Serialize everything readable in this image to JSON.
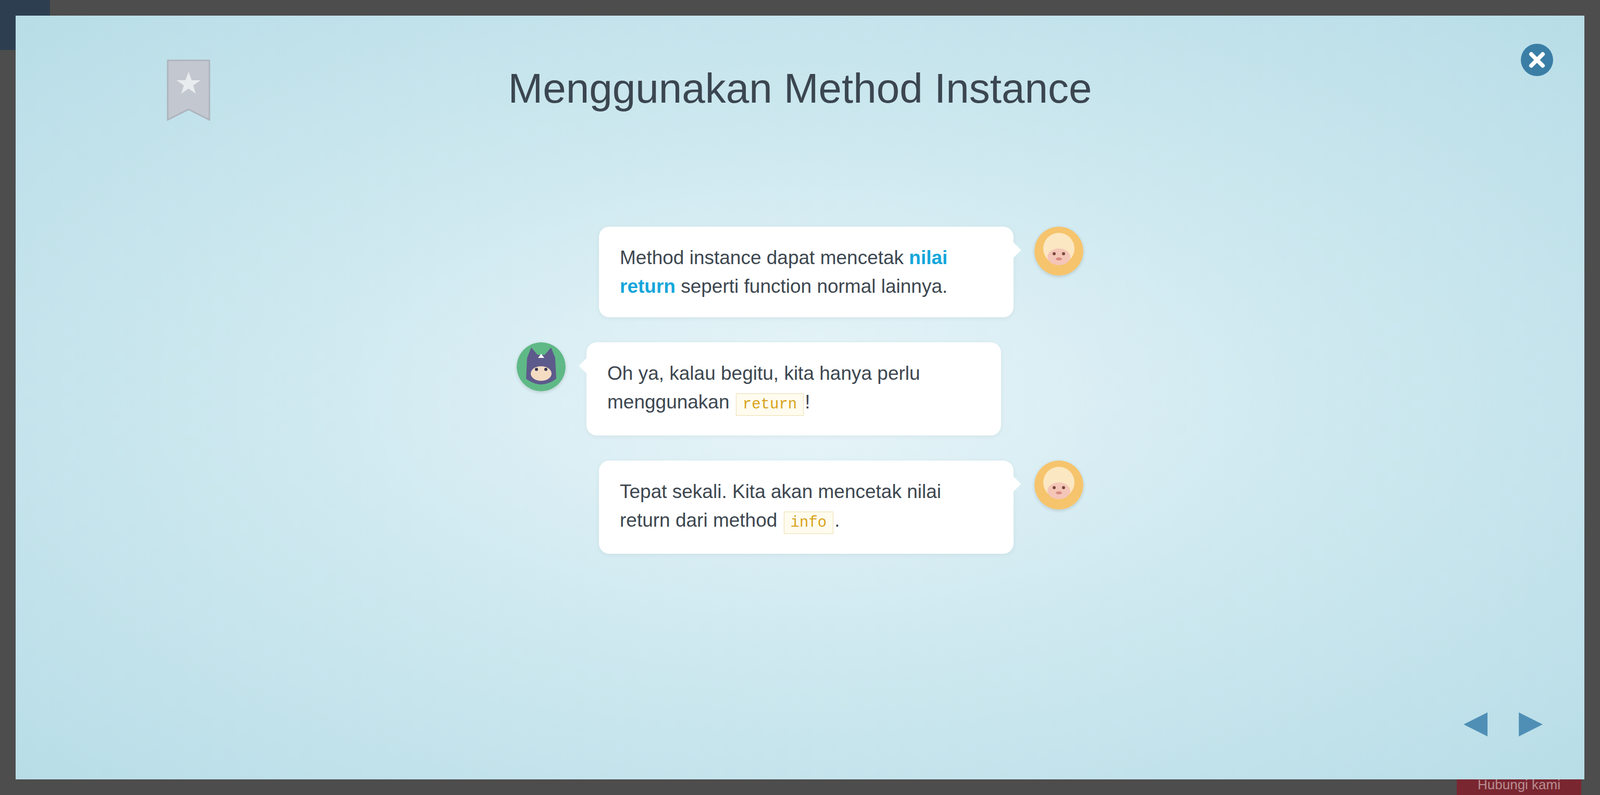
{
  "lesson": {
    "title": "Menggunakan Method Instance",
    "bookmarked": false
  },
  "messages": [
    {
      "kind": "sheep",
      "segments": [
        {
          "kind": "plain",
          "text": "Method instance dapat mencetak "
        },
        {
          "kind": "bold",
          "text": "nilai return"
        },
        {
          "kind": "plain",
          "text": " seperti function normal lainnya."
        }
      ]
    },
    {
      "kind": "cat",
      "segments": [
        {
          "kind": "plain",
          "text": "Oh ya, kalau begitu, kita hanya perlu menggunakan "
        },
        {
          "kind": "code",
          "text": "return"
        },
        {
          "kind": "plain",
          "text": "!"
        }
      ]
    },
    {
      "kind": "sheep",
      "segments": [
        {
          "kind": "plain",
          "text": "Tepat sekali. Kita akan mencetak nilai return dari method "
        },
        {
          "kind": "code",
          "text": "info"
        },
        {
          "kind": "plain",
          "text": "."
        }
      ]
    }
  ],
  "navigation": {
    "previous": "◀",
    "next": "▶"
  },
  "contact": "Hubungi kami"
}
